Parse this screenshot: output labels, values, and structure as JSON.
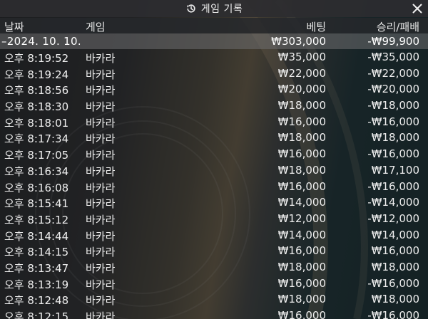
{
  "window": {
    "title": "게임 기록",
    "title_icon": "history-icon",
    "close_icon": "close-icon"
  },
  "columns": {
    "date": "날짜",
    "game": "게임",
    "bet": "베팅",
    "result": "승리/패배"
  },
  "summary": {
    "date": "–2024. 10. 10.",
    "bet": "₩303,000",
    "result": "-₩99,900"
  },
  "rows": [
    {
      "time": "오후 8:19:52",
      "game": "바카라",
      "bet": "₩35,000",
      "result": "-₩35,000"
    },
    {
      "time": "오후 8:19:24",
      "game": "바카라",
      "bet": "₩22,000",
      "result": "-₩22,000"
    },
    {
      "time": "오후 8:18:56",
      "game": "바카라",
      "bet": "₩20,000",
      "result": "-₩20,000"
    },
    {
      "time": "오후 8:18:30",
      "game": "바카라",
      "bet": "₩18,000",
      "result": "-₩18,000"
    },
    {
      "time": "오후 8:18:01",
      "game": "바카라",
      "bet": "₩16,000",
      "result": "-₩16,000"
    },
    {
      "time": "오후 8:17:34",
      "game": "바카라",
      "bet": "₩18,000",
      "result": "₩18,000"
    },
    {
      "time": "오후 8:17:05",
      "game": "바카라",
      "bet": "₩16,000",
      "result": "-₩16,000"
    },
    {
      "time": "오후 8:16:34",
      "game": "바카라",
      "bet": "₩18,000",
      "result": "₩17,100"
    },
    {
      "time": "오후 8:16:08",
      "game": "바카라",
      "bet": "₩16,000",
      "result": "-₩16,000"
    },
    {
      "time": "오후 8:15:41",
      "game": "바카라",
      "bet": "₩14,000",
      "result": "-₩14,000"
    },
    {
      "time": "오후 8:15:12",
      "game": "바카라",
      "bet": "₩12,000",
      "result": "-₩12,000"
    },
    {
      "time": "오후 8:14:44",
      "game": "바카라",
      "bet": "₩14,000",
      "result": "₩14,000"
    },
    {
      "time": "오후 8:14:15",
      "game": "바카라",
      "bet": "₩16,000",
      "result": "₩16,000"
    },
    {
      "time": "오후 8:13:47",
      "game": "바카라",
      "bet": "₩18,000",
      "result": "₩18,000"
    },
    {
      "time": "오후 8:13:19",
      "game": "바카라",
      "bet": "₩16,000",
      "result": "-₩16,000"
    },
    {
      "time": "오후 8:12:48",
      "game": "바카라",
      "bet": "₩18,000",
      "result": "₩18,000"
    },
    {
      "time": "오후 8:12:15",
      "game": "바카라",
      "bet": "₩16,000",
      "result": "-₩16,000"
    }
  ]
}
